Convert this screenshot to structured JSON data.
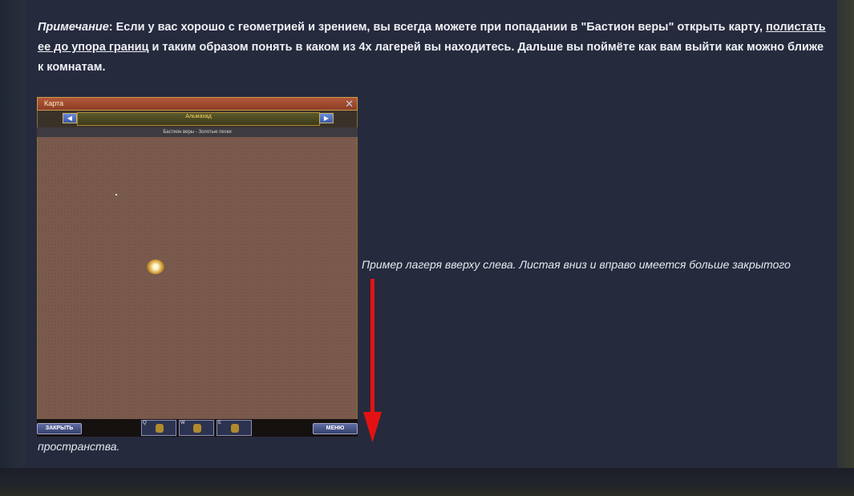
{
  "note": {
    "label": "Примечание",
    "text_1": ": Если у вас хорошо с геометрией и зрением, вы всегда можете при попадании в \"Бастион веры\" открыть карту, ",
    "link_text": "полистать ее до упора границ",
    "text_2": " и таким образом понять в каком из 4х лагерей вы находитесь. Дальше вы поймёте как вам выйти как можно ближе к комнатам."
  },
  "game": {
    "window_title": "Карта",
    "region_name": "Альмахад",
    "subregion": "Бастион веры - Золотые пески",
    "close_label": "ЗАКРЫТЬ",
    "menu_label": "МЕНЮ",
    "hotkeys": [
      "Q",
      "W",
      "E"
    ]
  },
  "caption": {
    "line_1": "Пример лагеря вверху слева. Листая вниз и вправо имеется больше закрытого",
    "line_2": "пространства."
  },
  "colors": {
    "panel": "#262a3d",
    "arrow": "#e31212"
  }
}
